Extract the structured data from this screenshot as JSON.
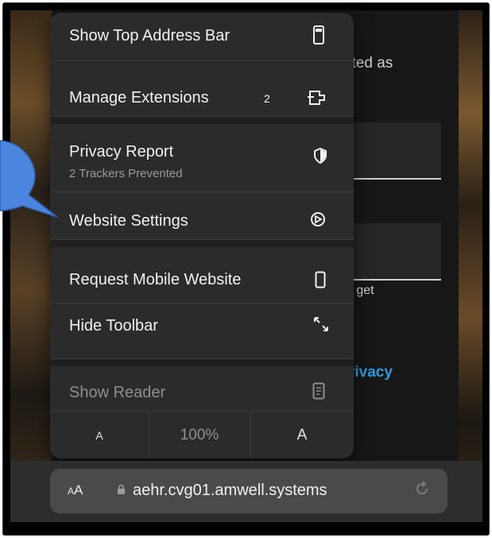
{
  "menu": {
    "items": [
      {
        "label": "Show Top Address Bar",
        "icon": "address-bar-top-icon"
      },
      {
        "label": "Manage Extensions",
        "badge": "2",
        "icon": "extension-icon"
      },
      {
        "label": "Privacy Report",
        "sub": "2 Trackers Prevented",
        "icon": "shield-icon"
      },
      {
        "label": "Website Settings",
        "icon": "website-settings-icon"
      },
      {
        "label": "Request Mobile Website",
        "icon": "mobile-device-icon"
      },
      {
        "label": "Hide Toolbar",
        "icon": "expand-arrows-icon"
      },
      {
        "label": "Show Reader",
        "icon": "reader-icon"
      }
    ],
    "zoom": {
      "smaller": "A",
      "level": "100%",
      "larger": "A"
    }
  },
  "background": {
    "text_1": "sted as",
    "text_2": "u get",
    "link": "rivacy"
  },
  "address_bar": {
    "aa_small": "A",
    "aa_large": "A",
    "url": "aehr.cvg01.amwell.systems",
    "lock_icon": "lock-icon",
    "reload_icon": "reload-icon"
  },
  "colors": {
    "menu_bg": "#2b2b2c",
    "link": "#2f9be0",
    "callout": "#4a86e0"
  }
}
